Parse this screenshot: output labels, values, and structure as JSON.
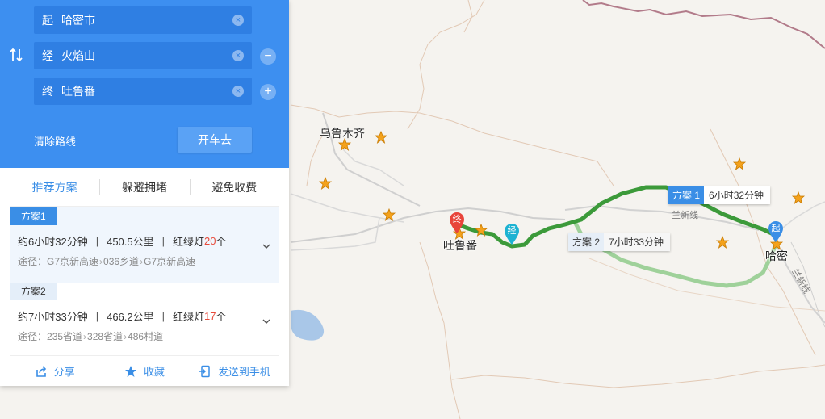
{
  "route_form": {
    "start": {
      "label": "起",
      "value": "哈密市"
    },
    "via": {
      "label": "经",
      "value": "火焰山"
    },
    "end": {
      "label": "终",
      "value": "吐鲁番"
    },
    "clear_route": "清除路线",
    "drive_button": "开车去"
  },
  "tabs": [
    {
      "label": "推荐方案",
      "active": true
    },
    {
      "label": "躲避拥堵",
      "active": false
    },
    {
      "label": "避免收费",
      "active": false
    }
  ],
  "plans": [
    {
      "name": "方案1",
      "time": "约6小时32分钟",
      "distance": "450.5公里",
      "lights_prefix": "红绿灯",
      "lights_count": "20",
      "lights_suffix": "个",
      "path_prefix": "途径：",
      "path": [
        "G7京新高速",
        "036乡道",
        "G7京新高速"
      ]
    },
    {
      "name": "方案2",
      "time": "约7小时33分钟",
      "distance": "466.2公里",
      "lights_prefix": "红绿灯",
      "lights_count": "17",
      "lights_suffix": "个",
      "path_prefix": "途径：",
      "path": [
        "235省道",
        "328省道",
        "486村道"
      ]
    }
  ],
  "actions": {
    "share": "分享",
    "favorite": "收藏",
    "send": "发送到手机"
  },
  "map": {
    "cities": {
      "urumqi": "乌鲁木齐",
      "turpan": "吐鲁番",
      "hami": "哈密"
    },
    "roads": {
      "lanxin": "兰新线",
      "lanxin2": "兰新线"
    },
    "tag1": {
      "name": "方案 1",
      "time": "6小时32分钟"
    },
    "tag2": {
      "name": "方案 2",
      "time": "7小时33分钟"
    },
    "pins": {
      "start": "起",
      "via": "经",
      "end": "终"
    }
  },
  "colors": {
    "panel_blue": "#3d8ff0",
    "route_main": "#3c9a3a",
    "route_alt": "#9fd19a",
    "accent": "#3a8ee6",
    "red": "#e84a3a"
  }
}
